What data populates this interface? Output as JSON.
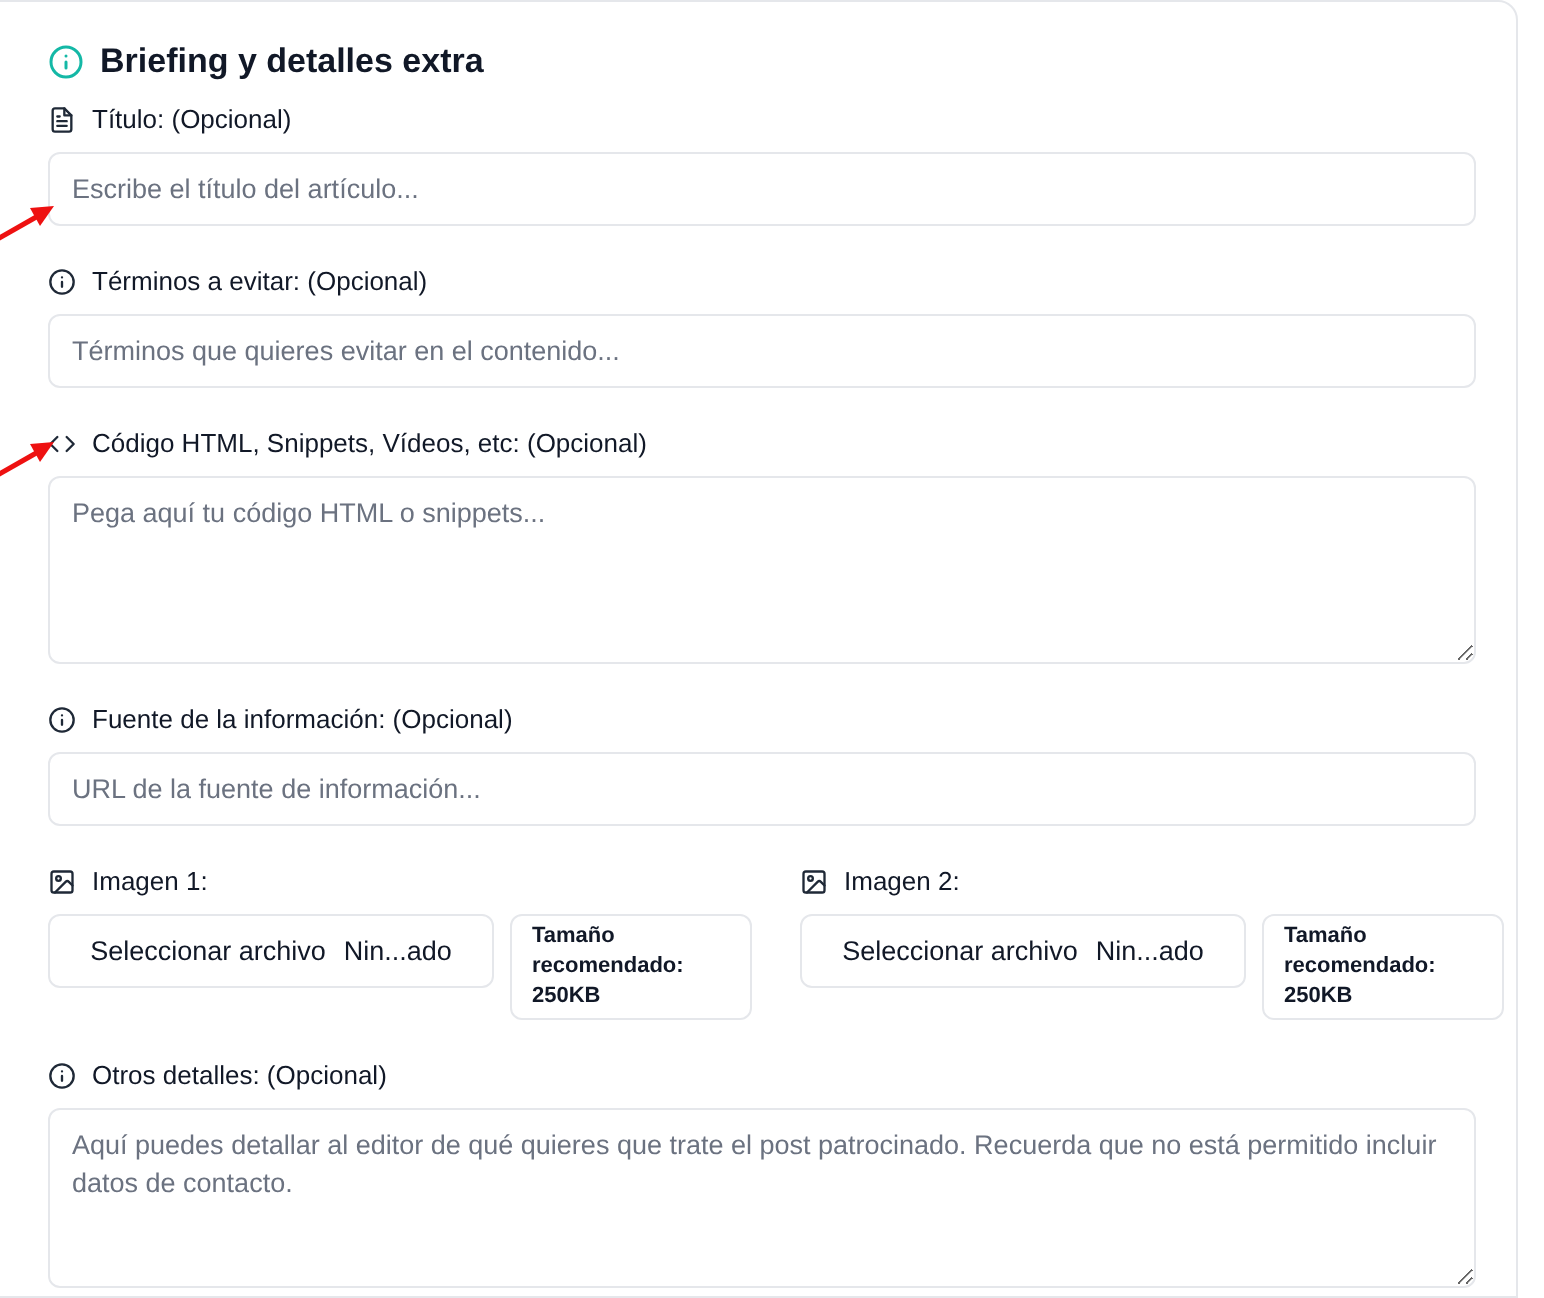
{
  "section": {
    "title": "Briefing y detalles extra"
  },
  "fields": [
    {
      "kind": "text",
      "label": "Título: (Opcional)",
      "placeholder": "Escribe el título del artículo...",
      "arrow": true
    },
    {
      "kind": "text",
      "label": "Términos a evitar: (Opcional)",
      "placeholder": "Términos que quieres evitar en el contenido...",
      "arrow": false
    },
    {
      "kind": "textarea",
      "label": "Código HTML, Snippets, Vídeos, etc: (Opcional)",
      "placeholder": "Pega aquí tu código HTML o snippets...",
      "arrow": true
    },
    {
      "kind": "text",
      "label": "Fuente de la información: (Opcional)",
      "placeholder": "URL de la fuente de información...",
      "arrow": false
    },
    {
      "kind": "files",
      "images": [
        {
          "label": "Imagen 1:",
          "button": "Seleccionar archivo",
          "file": "Nin...ado",
          "hint": "Tamaño recomendado: 250KB"
        },
        {
          "label": "Imagen 2:",
          "button": "Seleccionar archivo",
          "file": "Nin...ado",
          "hint": "Tamaño recomendado: 250KB"
        }
      ]
    },
    {
      "kind": "textarea",
      "label": "Otros detalles: (Opcional)",
      "placeholder": "Aquí puedes detallar al editor de qué quieres que trate el post patrocinado. Recuerda que no está permitido incluir datos de contacto.",
      "arrow": false
    }
  ]
}
